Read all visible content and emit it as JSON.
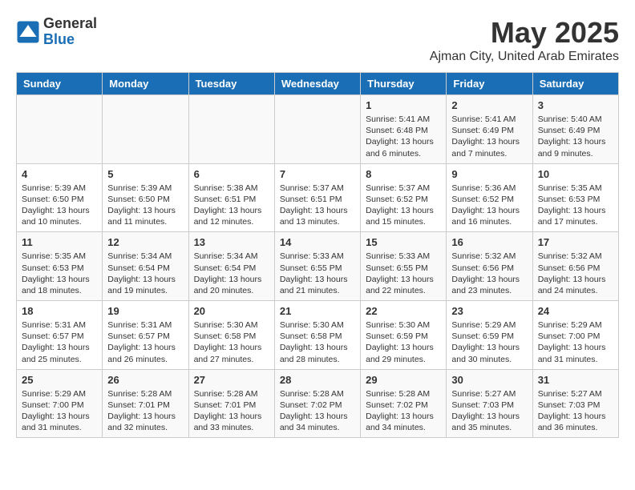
{
  "header": {
    "logo_general": "General",
    "logo_blue": "Blue",
    "month": "May 2025",
    "location": "Ajman City, United Arab Emirates"
  },
  "weekdays": [
    "Sunday",
    "Monday",
    "Tuesday",
    "Wednesday",
    "Thursday",
    "Friday",
    "Saturday"
  ],
  "weeks": [
    [
      {
        "num": "",
        "info": ""
      },
      {
        "num": "",
        "info": ""
      },
      {
        "num": "",
        "info": ""
      },
      {
        "num": "",
        "info": ""
      },
      {
        "num": "1",
        "info": "Sunrise: 5:41 AM\nSunset: 6:48 PM\nDaylight: 13 hours\nand 6 minutes."
      },
      {
        "num": "2",
        "info": "Sunrise: 5:41 AM\nSunset: 6:49 PM\nDaylight: 13 hours\nand 7 minutes."
      },
      {
        "num": "3",
        "info": "Sunrise: 5:40 AM\nSunset: 6:49 PM\nDaylight: 13 hours\nand 9 minutes."
      }
    ],
    [
      {
        "num": "4",
        "info": "Sunrise: 5:39 AM\nSunset: 6:50 PM\nDaylight: 13 hours\nand 10 minutes."
      },
      {
        "num": "5",
        "info": "Sunrise: 5:39 AM\nSunset: 6:50 PM\nDaylight: 13 hours\nand 11 minutes."
      },
      {
        "num": "6",
        "info": "Sunrise: 5:38 AM\nSunset: 6:51 PM\nDaylight: 13 hours\nand 12 minutes."
      },
      {
        "num": "7",
        "info": "Sunrise: 5:37 AM\nSunset: 6:51 PM\nDaylight: 13 hours\nand 13 minutes."
      },
      {
        "num": "8",
        "info": "Sunrise: 5:37 AM\nSunset: 6:52 PM\nDaylight: 13 hours\nand 15 minutes."
      },
      {
        "num": "9",
        "info": "Sunrise: 5:36 AM\nSunset: 6:52 PM\nDaylight: 13 hours\nand 16 minutes."
      },
      {
        "num": "10",
        "info": "Sunrise: 5:35 AM\nSunset: 6:53 PM\nDaylight: 13 hours\nand 17 minutes."
      }
    ],
    [
      {
        "num": "11",
        "info": "Sunrise: 5:35 AM\nSunset: 6:53 PM\nDaylight: 13 hours\nand 18 minutes."
      },
      {
        "num": "12",
        "info": "Sunrise: 5:34 AM\nSunset: 6:54 PM\nDaylight: 13 hours\nand 19 minutes."
      },
      {
        "num": "13",
        "info": "Sunrise: 5:34 AM\nSunset: 6:54 PM\nDaylight: 13 hours\nand 20 minutes."
      },
      {
        "num": "14",
        "info": "Sunrise: 5:33 AM\nSunset: 6:55 PM\nDaylight: 13 hours\nand 21 minutes."
      },
      {
        "num": "15",
        "info": "Sunrise: 5:33 AM\nSunset: 6:55 PM\nDaylight: 13 hours\nand 22 minutes."
      },
      {
        "num": "16",
        "info": "Sunrise: 5:32 AM\nSunset: 6:56 PM\nDaylight: 13 hours\nand 23 minutes."
      },
      {
        "num": "17",
        "info": "Sunrise: 5:32 AM\nSunset: 6:56 PM\nDaylight: 13 hours\nand 24 minutes."
      }
    ],
    [
      {
        "num": "18",
        "info": "Sunrise: 5:31 AM\nSunset: 6:57 PM\nDaylight: 13 hours\nand 25 minutes."
      },
      {
        "num": "19",
        "info": "Sunrise: 5:31 AM\nSunset: 6:57 PM\nDaylight: 13 hours\nand 26 minutes."
      },
      {
        "num": "20",
        "info": "Sunrise: 5:30 AM\nSunset: 6:58 PM\nDaylight: 13 hours\nand 27 minutes."
      },
      {
        "num": "21",
        "info": "Sunrise: 5:30 AM\nSunset: 6:58 PM\nDaylight: 13 hours\nand 28 minutes."
      },
      {
        "num": "22",
        "info": "Sunrise: 5:30 AM\nSunset: 6:59 PM\nDaylight: 13 hours\nand 29 minutes."
      },
      {
        "num": "23",
        "info": "Sunrise: 5:29 AM\nSunset: 6:59 PM\nDaylight: 13 hours\nand 30 minutes."
      },
      {
        "num": "24",
        "info": "Sunrise: 5:29 AM\nSunset: 7:00 PM\nDaylight: 13 hours\nand 31 minutes."
      }
    ],
    [
      {
        "num": "25",
        "info": "Sunrise: 5:29 AM\nSunset: 7:00 PM\nDaylight: 13 hours\nand 31 minutes."
      },
      {
        "num": "26",
        "info": "Sunrise: 5:28 AM\nSunset: 7:01 PM\nDaylight: 13 hours\nand 32 minutes."
      },
      {
        "num": "27",
        "info": "Sunrise: 5:28 AM\nSunset: 7:01 PM\nDaylight: 13 hours\nand 33 minutes."
      },
      {
        "num": "28",
        "info": "Sunrise: 5:28 AM\nSunset: 7:02 PM\nDaylight: 13 hours\nand 34 minutes."
      },
      {
        "num": "29",
        "info": "Sunrise: 5:28 AM\nSunset: 7:02 PM\nDaylight: 13 hours\nand 34 minutes."
      },
      {
        "num": "30",
        "info": "Sunrise: 5:27 AM\nSunset: 7:03 PM\nDaylight: 13 hours\nand 35 minutes."
      },
      {
        "num": "31",
        "info": "Sunrise: 5:27 AM\nSunset: 7:03 PM\nDaylight: 13 hours\nand 36 minutes."
      }
    ]
  ]
}
